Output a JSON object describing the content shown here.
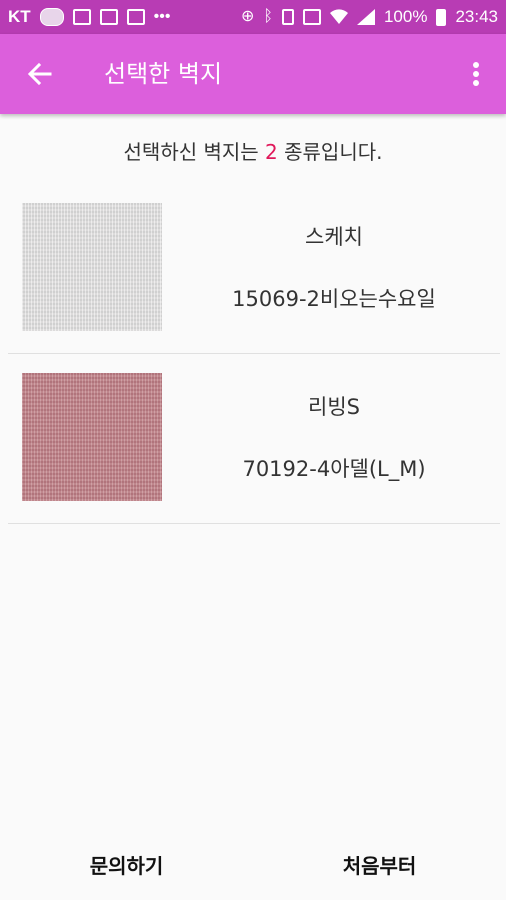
{
  "status_bar": {
    "carrier": "KT",
    "battery": "100%",
    "time": "23:43",
    "icons": [
      "carrier-logo-icon",
      "sms-icon",
      "gmail-icon",
      "gallery-icon",
      "dots-icon",
      "data-saver-icon",
      "bluetooth-icon",
      "vibrate-icon",
      "nfc-icon",
      "wifi-icon",
      "signal-icon",
      "battery-icon"
    ]
  },
  "app_bar": {
    "title": "선택한 벽지",
    "color": "#dc5fdc"
  },
  "summary": {
    "prefix": "선택하신 벽지는 ",
    "count": "2",
    "suffix": " 종류입니다.",
    "count_color": "#e0185a"
  },
  "items": [
    {
      "name": "스케치",
      "code": "15069-2비오는수요일",
      "swatch_color": "#e0dfdf"
    },
    {
      "name": "리빙S",
      "code": "70192-4아델(L_M)",
      "swatch_color": "#c48a90"
    }
  ],
  "bottom": {
    "inquiry_label": "문의하기",
    "restart_label": "처음부터"
  }
}
